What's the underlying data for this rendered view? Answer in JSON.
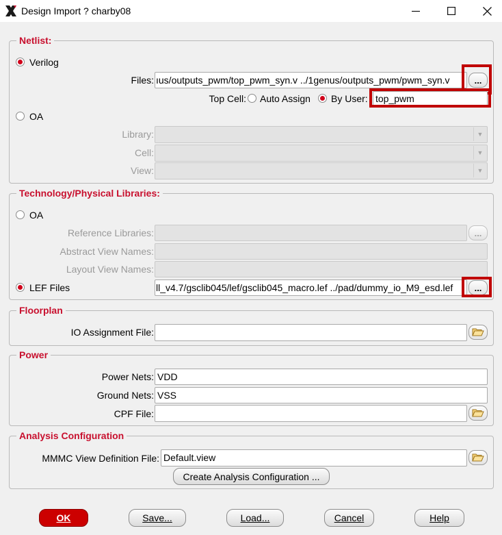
{
  "window": {
    "title": "Design Import ? charby08",
    "logo_icon": "xilinx-x-logo",
    "minimize_icon": "minimize-icon",
    "maximize_icon": "maximize-icon",
    "close_icon": "close-icon"
  },
  "netlist": {
    "group_title": "Netlist:",
    "verilog_label": "Verilog",
    "verilog_selected": true,
    "files_label": "Files:",
    "files_value": "ıus/outputs_pwm/top_pwm_syn.v ../1genus/outputs_pwm/pwm_syn.v",
    "browse_label": "...",
    "top_cell_label": "Top Cell:",
    "auto_assign_label": "Auto Assign",
    "by_user_label": "By User:",
    "by_user_selected": true,
    "top_cell_value": "top_pwm",
    "oa_label": "OA",
    "library_label": "Library:",
    "cell_label": "Cell:",
    "view_label": "View:"
  },
  "tech": {
    "group_title": "Technology/Physical Libraries:",
    "oa_label": "OA",
    "reference_libraries_label": "Reference Libraries:",
    "abstract_view_names_label": "Abstract View Names:",
    "layout_view_names_label": "Layout View Names:",
    "lef_files_label": "LEF Files",
    "lef_selected": true,
    "lef_files_value": "ll_v4.7/gsclib045/lef/gsclib045_macro.lef ../pad/dummy_io_M9_esd.lef",
    "browse_label": "..."
  },
  "floorplan": {
    "group_title": "Floorplan",
    "io_assignment_label": "IO Assignment File:",
    "io_assignment_value": ""
  },
  "power": {
    "group_title": "Power",
    "power_nets_label": "Power Nets:",
    "power_nets_value": "VDD",
    "ground_nets_label": "Ground Nets:",
    "ground_nets_value": "VSS",
    "cpf_file_label": "CPF File:",
    "cpf_file_value": ""
  },
  "analysis": {
    "group_title": "Analysis Configuration",
    "mmmc_label": "MMMC View Definition File:",
    "mmmc_value": "Default.view",
    "create_button": "Create Analysis Configuration ..."
  },
  "buttons": {
    "ok": "OK",
    "save": "Save...",
    "load": "Load...",
    "cancel": "Cancel",
    "help": "Help"
  },
  "colors": {
    "accent": "#c8102e",
    "highlight": "#c00000",
    "ok_button": "#cc0000"
  }
}
